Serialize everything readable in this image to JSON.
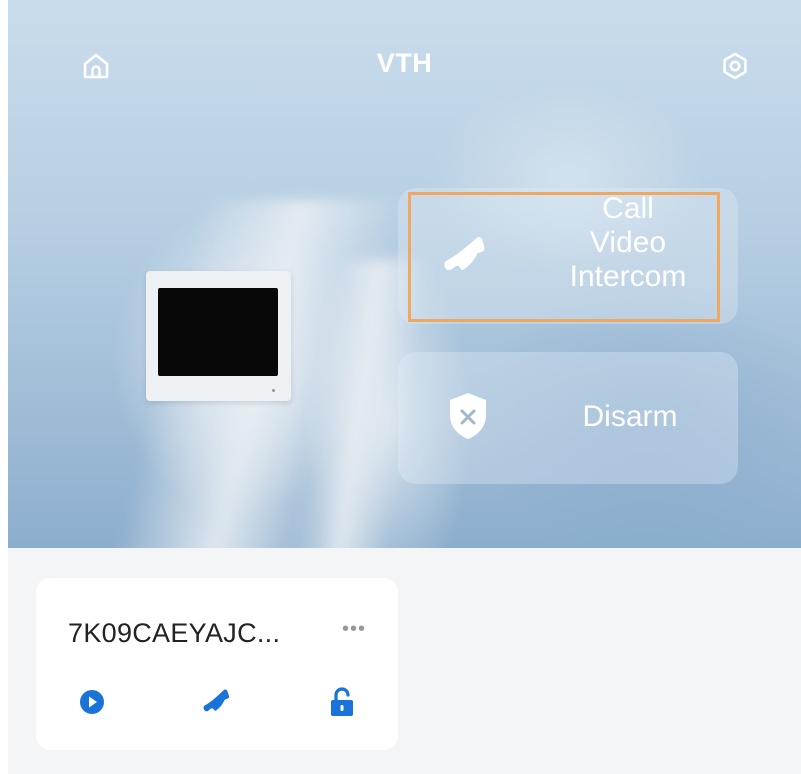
{
  "header": {
    "title": "VTH",
    "home_icon": "home-icon",
    "settings_icon": "settings-icon"
  },
  "actions": {
    "call": {
      "label_lines": [
        "Call",
        "Video",
        "Intercom"
      ],
      "icon": "phone-icon",
      "highlight_color": "#f0a860"
    },
    "disarm": {
      "label": "Disarm",
      "icon": "shield-x-icon"
    }
  },
  "device_card": {
    "name": "7K09CAEYAJC...",
    "more_label": "•••",
    "buttons": [
      {
        "icon": "play-icon"
      },
      {
        "icon": "phone-icon"
      },
      {
        "icon": "unlock-icon"
      }
    ]
  },
  "colors": {
    "accent": "#1a73d9",
    "title_text": "#ffffff",
    "highlight": "#f0a860"
  }
}
